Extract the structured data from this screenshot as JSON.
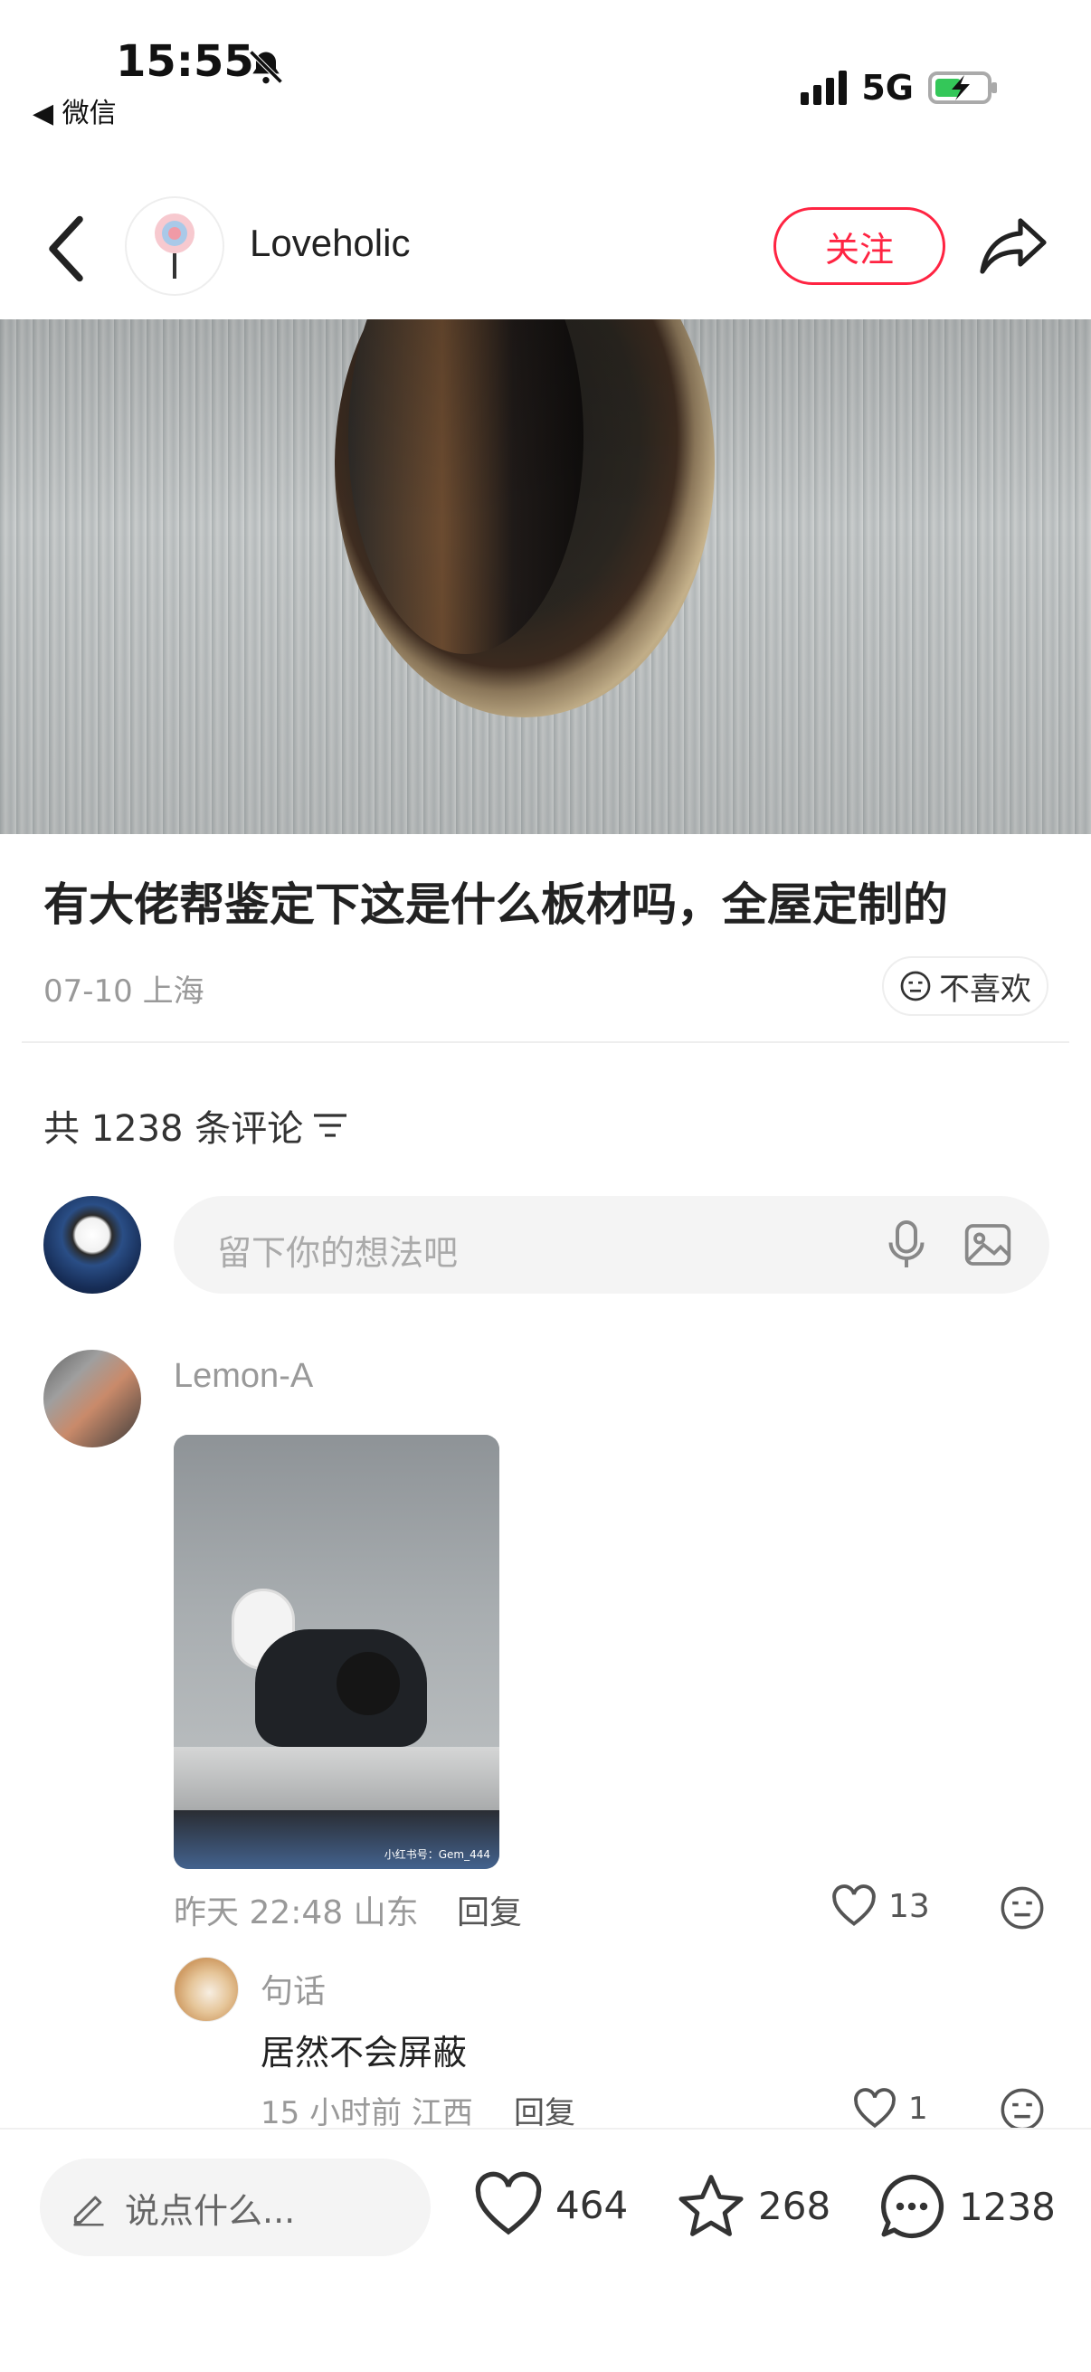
{
  "status_bar": {
    "time": "15:55",
    "back_app": "◀ 微信",
    "network": "5G"
  },
  "header": {
    "author_name": "Loveholic",
    "follow_label": "关注"
  },
  "post": {
    "title": "有大佬帮鉴定下这是什么板材吗，全屋定制的",
    "meta": "07-10 上海",
    "dislike_label": "不喜欢"
  },
  "comments": {
    "count_label": "共 1238 条评论",
    "input_placeholder": "留下你的想法吧",
    "items": [
      {
        "user": "Lemon-A",
        "meta": "昨天 22:48 山东",
        "reply_label": "回复",
        "likes": "13",
        "image_watermark": "小红书号：Gem_444",
        "replies": [
          {
            "user": "句话",
            "text": "居然不会屏蔽",
            "meta": "15 小时前 江西",
            "reply_label": "回复",
            "likes": "1"
          }
        ]
      }
    ]
  },
  "bottom_bar": {
    "input_placeholder": "说点什么...",
    "likes": "464",
    "collects": "268",
    "comments": "1238"
  },
  "colors": {
    "accent": "#ff2442",
    "muted_text": "#999999",
    "input_bg": "#f4f4f4"
  }
}
